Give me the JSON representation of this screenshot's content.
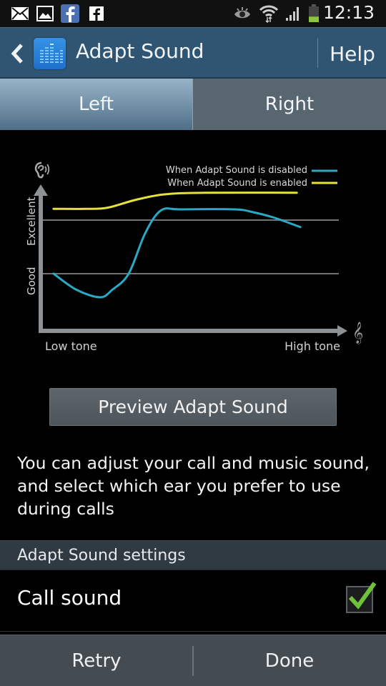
{
  "status_bar": {
    "time": "12:13",
    "left_icons": [
      "email-icon",
      "gallery-icon",
      "facebook-icon",
      "facebook-small-icon"
    ],
    "right_icons": [
      "smart-stay-eye-icon",
      "wifi-icon",
      "signal-icon",
      "battery-icon"
    ],
    "battery_level_fraction": 0.35
  },
  "action_bar": {
    "title": "Adapt Sound",
    "help_label": "Help"
  },
  "tabs": [
    {
      "label": "Left",
      "selected": true
    },
    {
      "label": "Right",
      "selected": false
    }
  ],
  "chart_data": {
    "type": "line",
    "title": "",
    "xlabel": "",
    "ylabel": "",
    "x_tick_labels": [
      "Low tone",
      "High tone"
    ],
    "y_tick_labels": [
      "Good",
      "Excellent"
    ],
    "xlim": [
      0,
      100
    ],
    "ylim": [
      -1.0,
      2.0
    ],
    "y_reference_lines": [
      {
        "label": "Good",
        "value": 0
      },
      {
        "label": "Excellent",
        "value": 1
      }
    ],
    "legend": "top-right",
    "series": [
      {
        "name": "When Adapt Sound is disabled",
        "color": "#29a9c4",
        "points": [
          [
            4.3,
            0.0
          ],
          [
            12,
            -0.3
          ],
          [
            19.9,
            -0.44
          ],
          [
            24,
            -0.3
          ],
          [
            29.5,
            0.0
          ],
          [
            35,
            0.75
          ],
          [
            40.3,
            1.18
          ],
          [
            47,
            1.2
          ],
          [
            65,
            1.2
          ],
          [
            71,
            1.15
          ],
          [
            78,
            1.05
          ],
          [
            87.1,
            0.87
          ]
        ]
      },
      {
        "name": "When Adapt Sound is enabled",
        "color": "#e6e03a",
        "points": [
          [
            4.3,
            1.21
          ],
          [
            15,
            1.21
          ],
          [
            22.3,
            1.23
          ],
          [
            32,
            1.38
          ],
          [
            41.5,
            1.48
          ],
          [
            55,
            1.51
          ],
          [
            85.9,
            1.51
          ]
        ]
      }
    ]
  },
  "preview_button_label": "Preview Adapt Sound",
  "description": "You can adjust your call and music sound, and select which ear you prefer to use during calls",
  "settings": {
    "section_title": "Adapt Sound settings",
    "call_sound": {
      "label": "Call sound",
      "checked": true
    }
  },
  "bottom_buttons": {
    "retry": "Retry",
    "done": "Done"
  }
}
